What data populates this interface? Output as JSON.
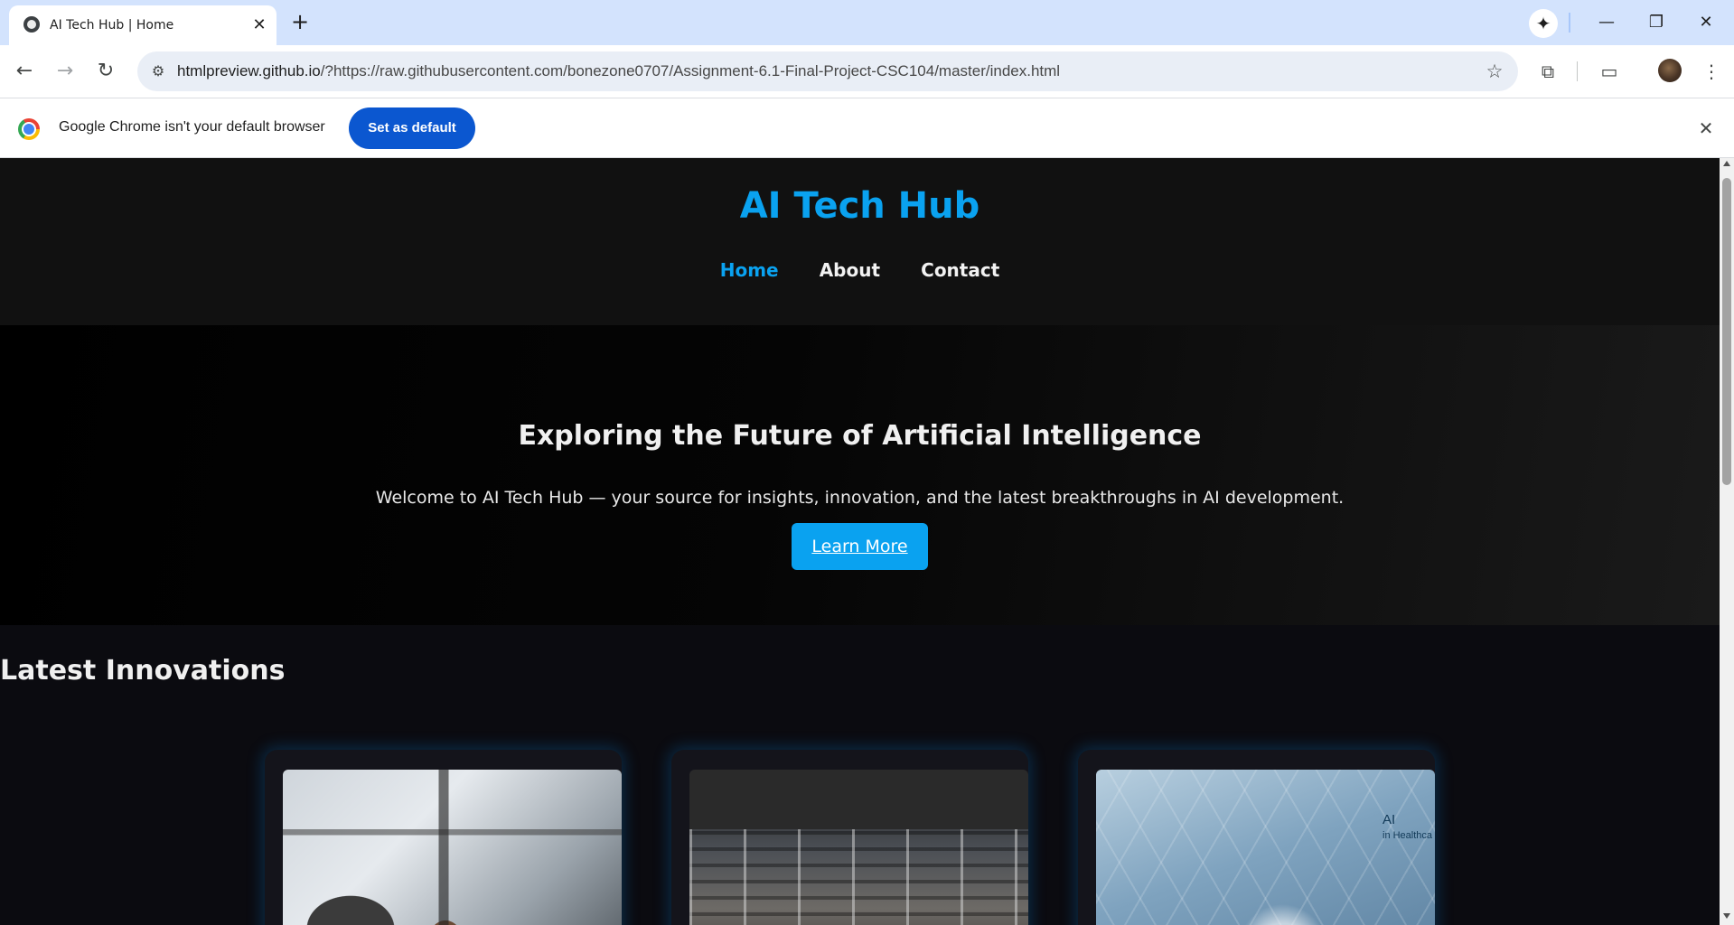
{
  "browser": {
    "tab_title": "AI Tech Hub | Home",
    "url_host": "htmlpreview.github.io",
    "url_rest": "/?https://raw.githubusercontent.com/bonezone0707/Assignment-6.1-Final-Project-CSC104/master/index.html",
    "infobar_message": "Google Chrome isn't your default browser",
    "infobar_button": "Set as default"
  },
  "icons": {
    "tab_close": "✕",
    "new_tab": "+",
    "gemini": "✦",
    "minimize": "—",
    "restore": "❐",
    "close_window": "✕",
    "back": "←",
    "forward": "→",
    "reload": "↻",
    "site_info": "⚙",
    "bookmark": "☆",
    "extensions": "⧉",
    "cast": "▭",
    "menu": "⋮",
    "infobar_close": "✕"
  },
  "site": {
    "title": "AI Tech Hub",
    "nav": [
      "Home",
      "About",
      "Contact"
    ],
    "hero_title": "Exploring the Future of Artificial Intelligence",
    "hero_subtitle": "Welcome to AI Tech Hub — your source for insights, innovation, and the latest breakthroughs in AI development.",
    "hero_button": "Learn More",
    "section_title": "Latest Innovations",
    "health_label_main": "AI",
    "health_label_small": "in Healthca"
  },
  "colors": {
    "accent": "#0aa2f0",
    "header_bg": "#111111",
    "page_bg": "#0b0b10",
    "chrome_tabstrip": "#d3e3fd",
    "chrome_button": "#0b57d0"
  }
}
